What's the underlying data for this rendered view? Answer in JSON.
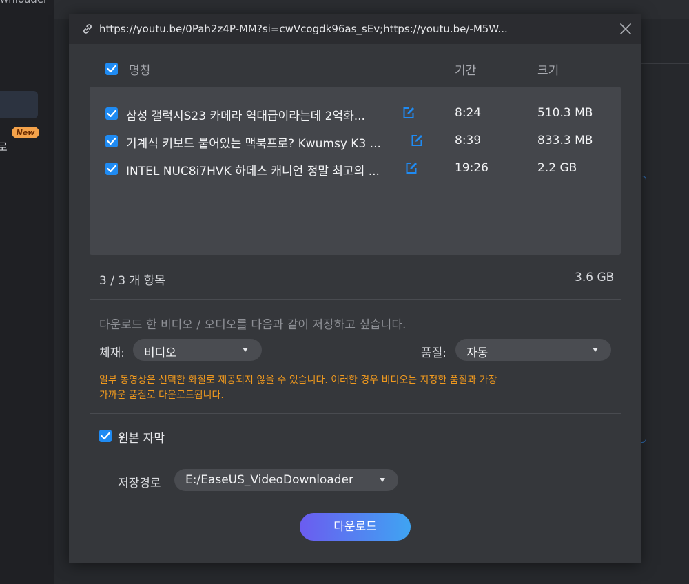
{
  "background": {
    "app_title": "wnloader",
    "sidebar_badge": "New",
    "sidebar_text": "로"
  },
  "dialog": {
    "url": "https://youtu.be/0Pah2z4P-MM?si=cwVcogdk96as_sEv;https://youtu.be/-M5W...",
    "columns": {
      "name": "명칭",
      "duration": "기간",
      "size": "크기"
    },
    "items": [
      {
        "title": "삼성 갤럭시S23 카메라 역대급이라는데 2억화...",
        "duration": "8:24",
        "size": "510.3 MB",
        "checked": true
      },
      {
        "title": "기계식 키보드 붙어있는 맥북프로? Kwumsy K3 ...",
        "duration": "8:39",
        "size": "833.3 MB",
        "checked": true
      },
      {
        "title": "INTEL NUC8i7HVK 하데스 캐니언 정말 최고의 ...",
        "duration": "19:26",
        "size": "2.2 GB",
        "checked": true
      }
    ],
    "count_text": "3 / 3 개 항목",
    "total_size": "3.6 GB",
    "save_desc": "다운로드 한 비디오 / 오디오를 다음과 같이 저장하고 싶습니다.",
    "format_label": "체재:",
    "format_value": "비디오",
    "quality_label": "품질:",
    "quality_value": "자동",
    "warning_line1": "일부 동영상은 선택한 화질로 제공되지 않을 수 있습니다. 이러한 경우 비디오는 지정한 품질과 가장",
    "warning_line2": "가까운 품질로 다운로드됩니다.",
    "subtitle_label": "원본 자막",
    "path_label": "저장경로",
    "path_value": "E:/EaseUS_VideoDownloader",
    "download_button": "다운로드"
  },
  "colors": {
    "accent": "#1f8bf3",
    "warning": "#f19a1e",
    "dialog_bg": "#35373b",
    "list_bg": "#44464b"
  }
}
